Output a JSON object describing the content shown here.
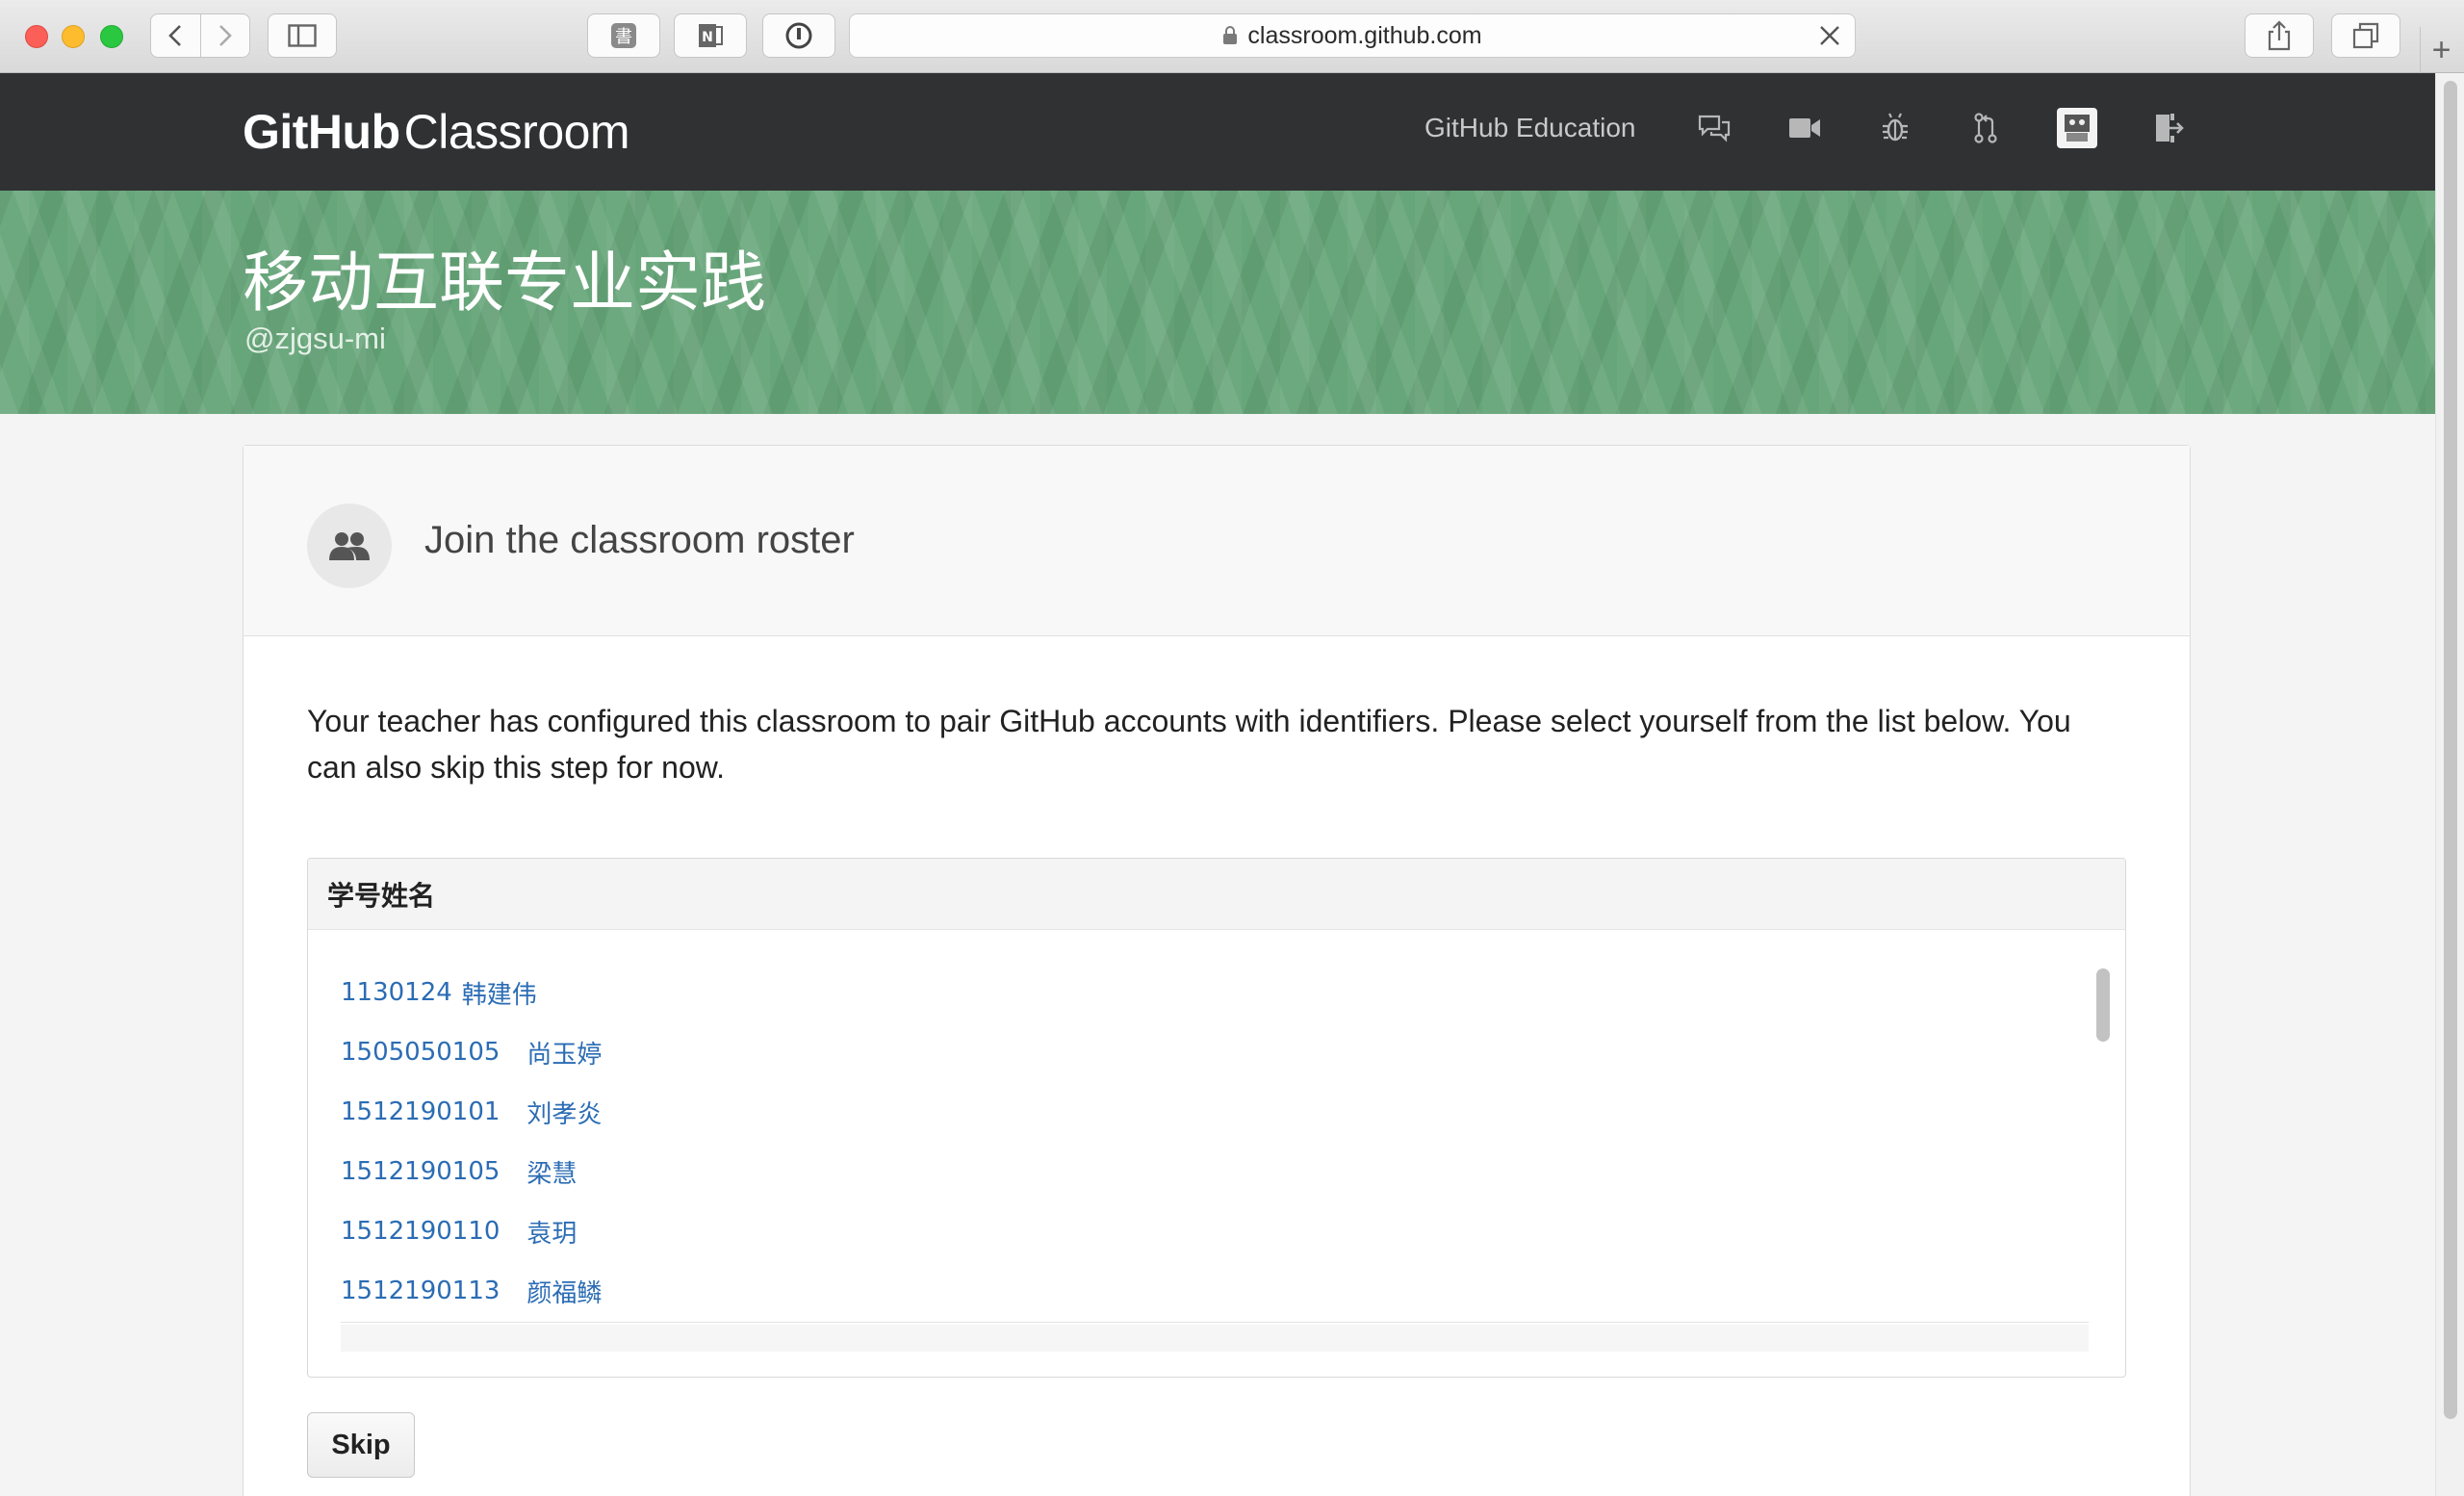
{
  "browser": {
    "url": "classroom.github.com",
    "new_tab": "+"
  },
  "header": {
    "logo_bold": "GitHub",
    "logo_light": "Classroom",
    "education_link": "GitHub Education"
  },
  "banner": {
    "title": "移动互联专业实践",
    "org": "@zjgsu-mi",
    "color": "#67a67a"
  },
  "card": {
    "title": "Join the classroom roster",
    "description": "Your teacher has configured this classroom to pair GitHub accounts with identifiers. Please select yourself from the list below. You can also skip this step for now.",
    "roster_header": "学号姓名",
    "skip_label": "Skip"
  },
  "roster": [
    {
      "id": "1130124",
      "name": "韩建伟"
    },
    {
      "id": "1505050105",
      "name": "尚玉婷"
    },
    {
      "id": "1512190101",
      "name": "刘孝炎"
    },
    {
      "id": "1512190105",
      "name": "梁慧"
    },
    {
      "id": "1512190110",
      "name": "袁玥"
    },
    {
      "id": "1512190113",
      "name": "颜福鳞"
    }
  ],
  "colors": {
    "header_bg": "#2f3133",
    "link": "#2b6cb4"
  }
}
